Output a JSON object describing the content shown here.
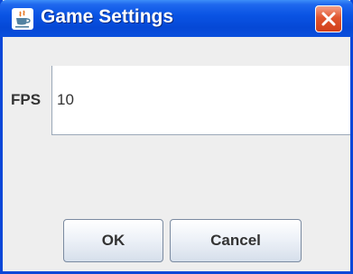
{
  "window": {
    "title": "Game Settings",
    "app_icon": "java-cup-icon",
    "close_icon": "close-icon"
  },
  "form": {
    "fps_label": "FPS",
    "fps_value": "10"
  },
  "buttons": {
    "ok_label": "OK",
    "cancel_label": "Cancel"
  },
  "colors": {
    "titlebar": "#0548d6",
    "close_button": "#e0562f",
    "dialog_background": "#eeeeee"
  }
}
